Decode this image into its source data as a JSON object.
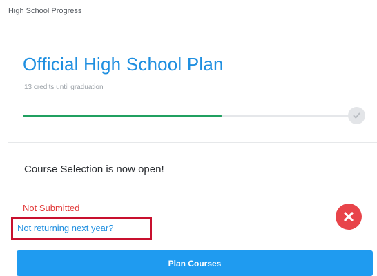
{
  "header": {
    "section_label": "High School Progress"
  },
  "plan": {
    "title": "Official High School Plan",
    "credits_text": "13 credits until graduation",
    "progress_fraction": 0.6
  },
  "course_selection": {
    "announcement": "Course Selection is now open!",
    "status": "Not Submitted",
    "status_color": "#e23a3a",
    "not_returning_link": "Not returning next year?",
    "plan_button_label": "Plan Courses"
  },
  "colors": {
    "accent": "#1f8fe0",
    "progress": "#20a060",
    "button": "#1f9bf0",
    "highlight_box": "#c8102e"
  },
  "icons": {
    "progress_end": "check-icon",
    "status": "close-icon"
  }
}
